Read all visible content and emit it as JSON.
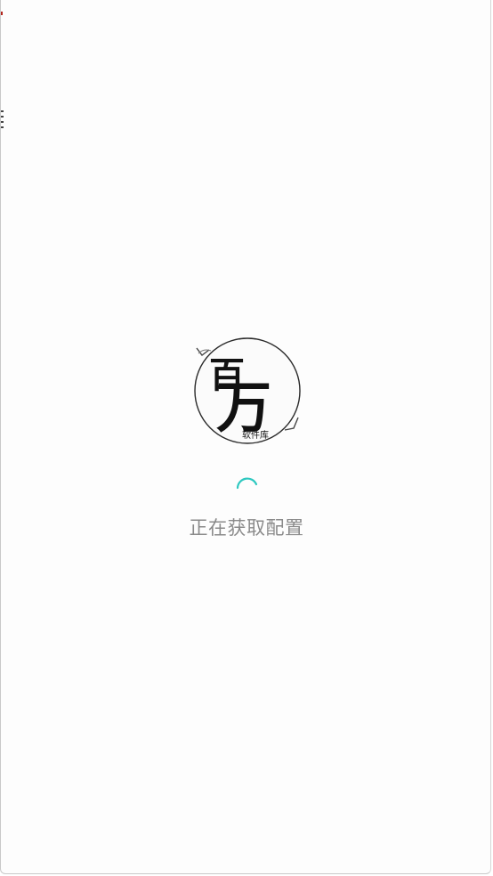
{
  "splash": {
    "logo": {
      "icon": "logo-seal-icon",
      "main_char_top": "百",
      "main_char_bottom": "万",
      "caption": "软件库"
    },
    "spinner": {
      "icon": "loading-spinner-icon",
      "color": "#2ec8c0"
    },
    "status_text": "正在获取配置"
  }
}
